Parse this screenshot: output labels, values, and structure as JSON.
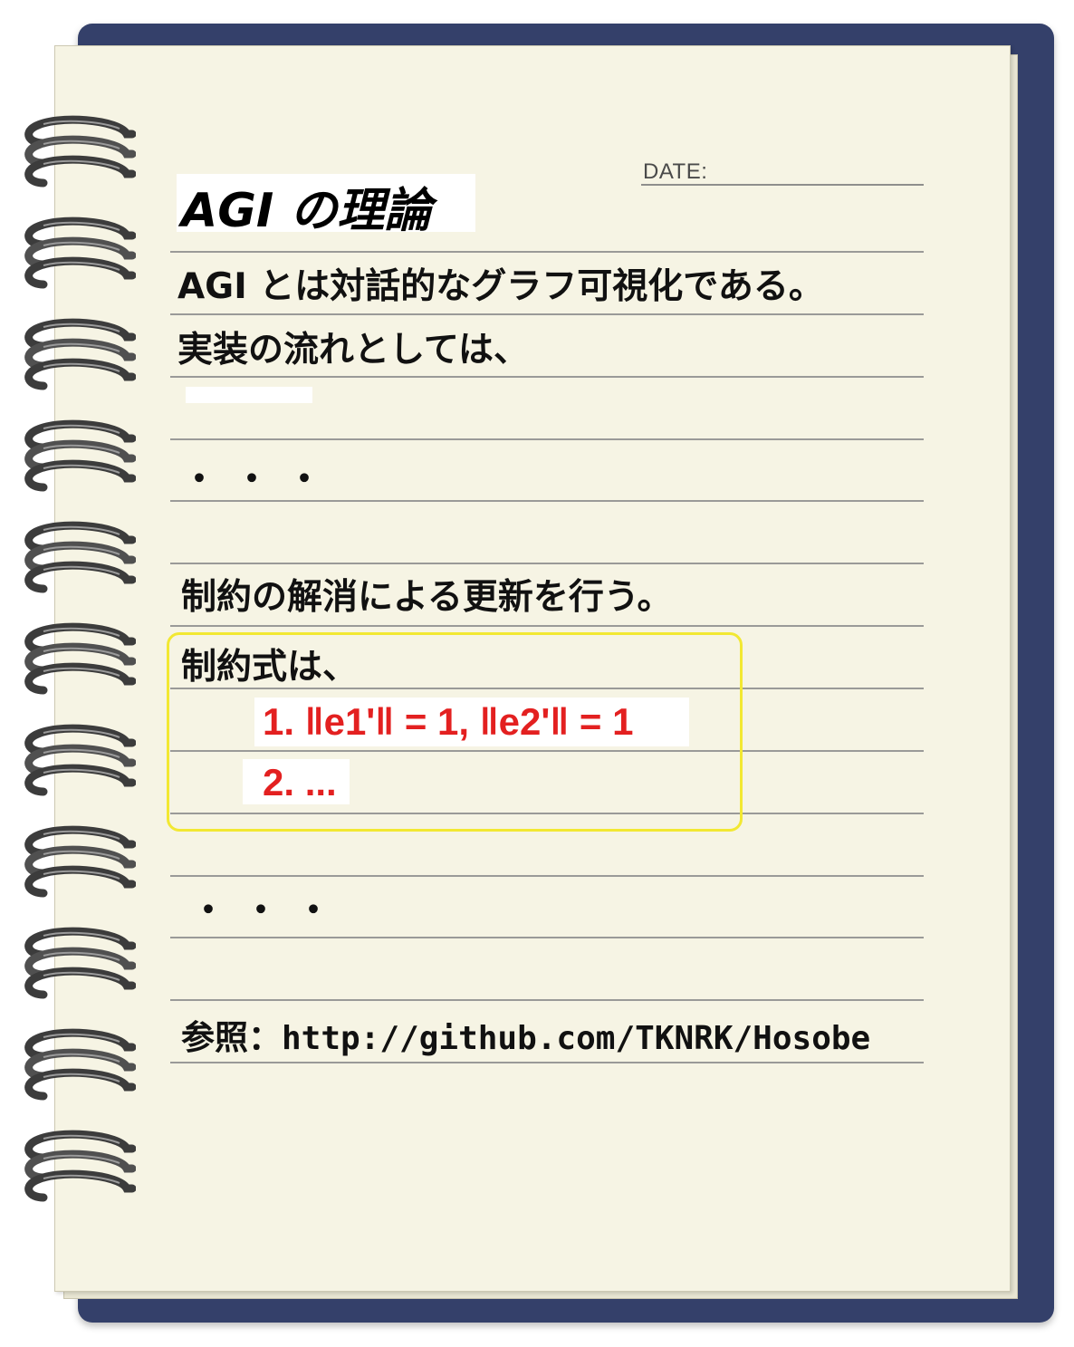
{
  "date_label": "DATE:",
  "title": "AGI の理論",
  "lines": {
    "line1": "AGI とは対話的なグラフ可視化である。",
    "line2": "実装の流れとしては、",
    "ellipsis1": "・・・",
    "line3": "制約の解消による更新を行う。",
    "line4": "制約式は、",
    "ellipsis2": "・・・"
  },
  "constraints": {
    "item1": "1. ‖e1'‖ = 1, ‖e2'‖ = 1",
    "item2": "2. ..."
  },
  "reference": {
    "label": "参照：",
    "url": "http://github.com/TKNRK/Hosobe"
  },
  "colors": {
    "cover": "#34406a",
    "paper": "#f6f4e4",
    "highlight_border": "#f2e832",
    "constraint_text": "#e32020"
  },
  "icons": [
    "spiral-ring-icon"
  ]
}
